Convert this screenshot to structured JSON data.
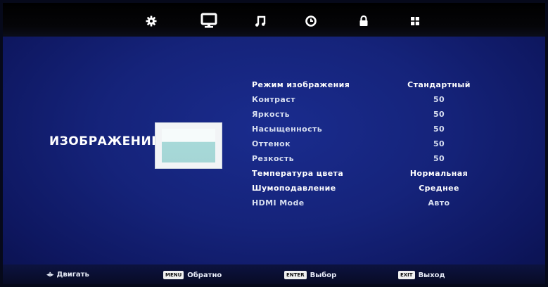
{
  "tabs": [
    {
      "icon": "gear-icon"
    },
    {
      "icon": "monitor-icon",
      "active": true
    },
    {
      "icon": "music-note-icon"
    },
    {
      "icon": "clock-icon"
    },
    {
      "icon": "lock-icon"
    },
    {
      "icon": "grid-icon"
    }
  ],
  "section": {
    "title": "ИЗОБРАЖЕНИЕ"
  },
  "settings": [
    {
      "label": "Режим изображения",
      "value": "Стандартный"
    },
    {
      "label": "Контраст",
      "value": "50"
    },
    {
      "label": "Яркость",
      "value": "50"
    },
    {
      "label": "Насыщенность",
      "value": "50"
    },
    {
      "label": "Оттенок",
      "value": "50"
    },
    {
      "label": "Резкость",
      "value": "50"
    },
    {
      "label": "Температура цвета",
      "value": "Нормальная"
    },
    {
      "label": "Шумоподавление",
      "value": "Среднее"
    },
    {
      "label": "HDMI Mode",
      "value": "Авто"
    }
  ],
  "footer": {
    "move": {
      "icon": "dpad-arrows-icon",
      "label": "Двигать"
    },
    "back": {
      "key": "MENU",
      "label": "Обратно"
    },
    "select": {
      "key": "ENTER",
      "label": "Выбор"
    },
    "exit": {
      "key": "EXIT",
      "label": "Выход"
    }
  },
  "colors": {
    "background": "#15237a",
    "topbar": "#000000",
    "text": "#ffffff"
  }
}
